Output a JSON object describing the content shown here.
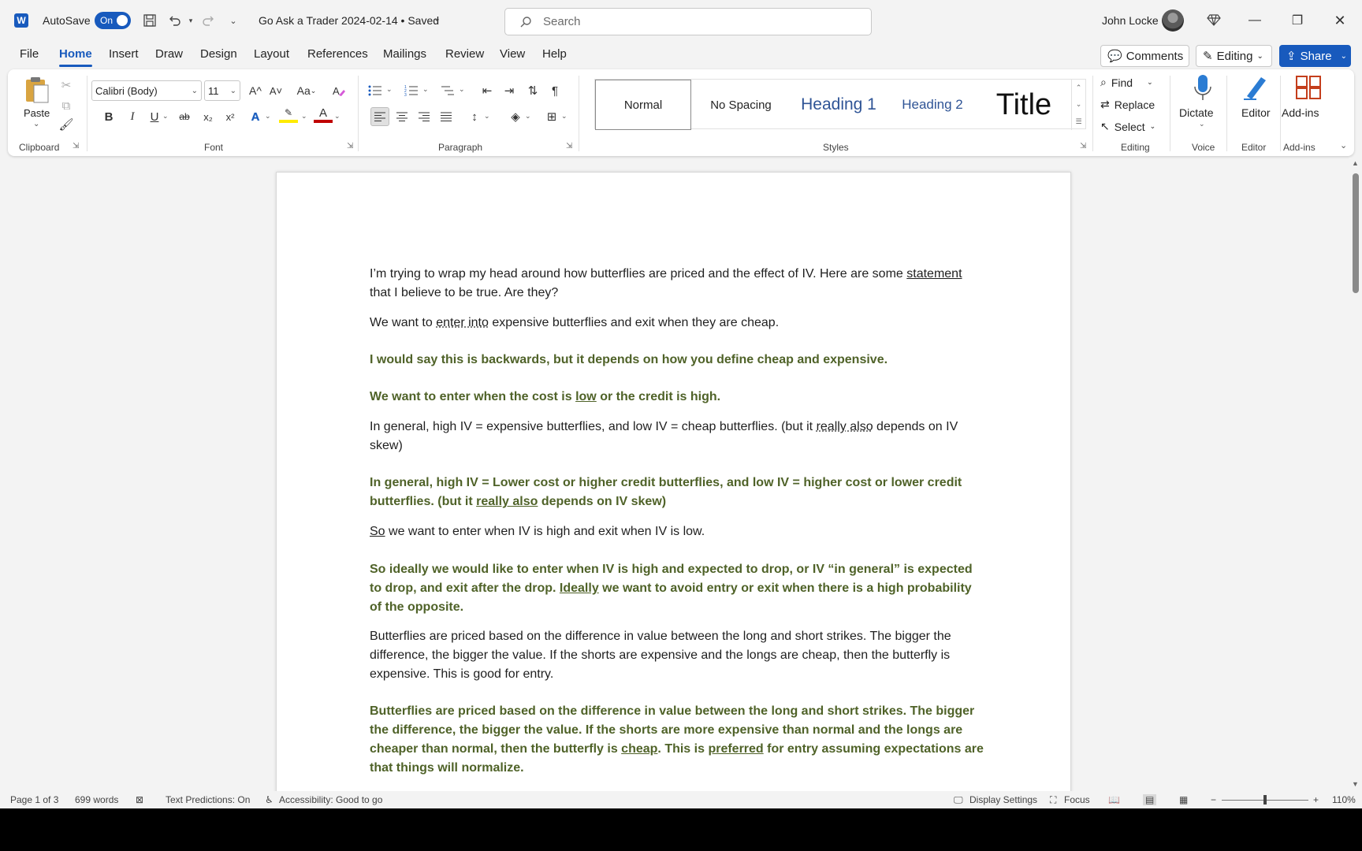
{
  "titlebar": {
    "autosave_label": "AutoSave",
    "autosave_state": "On",
    "doc_title": "Go Ask a Trader 2024-02-14 • Saved",
    "search_placeholder": "Search",
    "user_name": "John Locke"
  },
  "menu": {
    "tabs": [
      "File",
      "Home",
      "Insert",
      "Draw",
      "Design",
      "Layout",
      "References",
      "Mailings",
      "Review",
      "View",
      "Help"
    ],
    "active": "Home",
    "comments_label": "Comments",
    "editing_label": "Editing",
    "share_label": "Share"
  },
  "ribbon": {
    "clipboard": {
      "paste": "Paste",
      "label": "Clipboard"
    },
    "font": {
      "name": "Calibri (Body)",
      "size": "11",
      "label": "Font",
      "grow": "A^",
      "shrink": "A˅",
      "case": "Aa",
      "bold": "B",
      "italic": "I",
      "underline": "U",
      "strike": "ab",
      "sub": "x₂",
      "sup": "x²",
      "effects": "A",
      "highlight": "ab",
      "color": "A"
    },
    "paragraph": {
      "label": "Paragraph"
    },
    "styles": {
      "label": "Styles",
      "items": [
        "Normal",
        "No Spacing",
        "Heading 1",
        "Heading 2",
        "Title"
      ]
    },
    "editing": {
      "find": "Find",
      "replace": "Replace",
      "select": "Select",
      "label": "Editing"
    },
    "voice": {
      "dictate": "Dictate",
      "label": "Voice"
    },
    "editor": {
      "editor": "Editor",
      "label": "Editor"
    },
    "addins": {
      "addins": "Add-ins",
      "label": "Add-ins"
    }
  },
  "document": {
    "p1a": "I’m trying to wrap my head around how butterflies are priced and the effect of IV. Here are some",
    "p1b_u": "statement",
    "p1b": " that I believe to be true. Are they?",
    "p2a": "We want to ",
    "p2_u": "enter into",
    "p2b": " expensive butterflies and exit when they are cheap.",
    "p3": "I would say this is backwards, but it depends on how you define cheap and expensive.",
    "p4a": "We want to enter when the cost is ",
    "p4_u": "low",
    "p4b": " or the credit is high.",
    "p5a": "In general, high IV = expensive butterflies, and low IV = cheap butterflies. (but it ",
    "p5_u": "really also",
    "p5b": " depends on IV skew)",
    "p6a": "In general, high IV = Lower cost or higher credit butterflies, and low IV = higher cost or lower credit butterflies. (but it ",
    "p6_u": "really also",
    "p6b": " depends on IV skew)",
    "p7_u": "So",
    "p7b": " we want to enter when IV is high and exit when IV is low.",
    "p8a": "So ideally we would like to enter when IV is high and expected to drop, or IV “in general” is expected to drop, and exit after the drop. ",
    "p8_u": "Ideally",
    "p8b": " we want to avoid entry or exit when there is a high probability of the opposite.",
    "p9": "Butterflies are priced based on the difference in value between the long and short strikes. The bigger the difference, the bigger the value. If the shorts are expensive and the longs are cheap, then the butterfly is expensive. This is good for entry.",
    "p10a": "Butterflies are priced based on the difference in value between the long and short strikes. The bigger the difference, the bigger the value. If the shorts are more expensive than normal and the longs are cheaper than normal, then the butterfly is ",
    "p10_u1": "cheap",
    "p10b": ". This is ",
    "p10_u2": "preferred",
    "p10c": " for entry assuming expectations are that things will normalize."
  },
  "status": {
    "page": "Page 1 of 3",
    "words": "699 words",
    "predictions": "Text Predictions: On",
    "accessibility": "Accessibility: Good to go",
    "display": "Display Settings",
    "focus": "Focus",
    "zoom": "110%"
  },
  "colors": {
    "accent": "#185abd",
    "comment_text": "#4f6228"
  }
}
